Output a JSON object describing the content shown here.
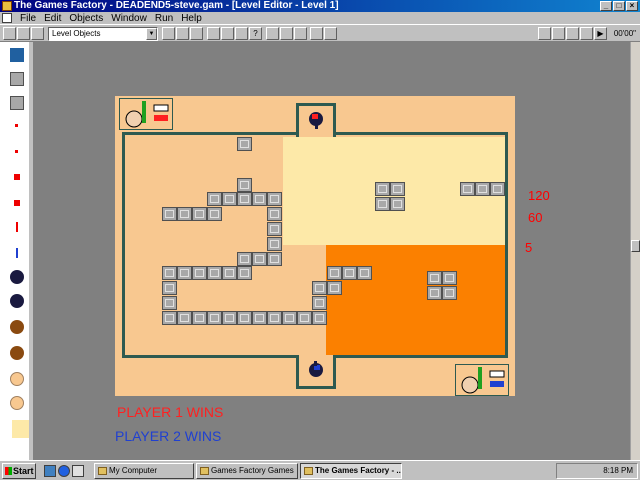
{
  "window": {
    "title": "The Games Factory - DEADEND5-steve.gam - [Level Editor - Level 1]",
    "controls": [
      "_",
      "□",
      "×"
    ]
  },
  "menu": [
    "File",
    "Edit",
    "Objects",
    "Window",
    "Run",
    "Help"
  ],
  "toolbar": {
    "object_selector": "Level Objects",
    "zoom": "00'00\""
  },
  "level": {
    "hud_numbers": [
      "120",
      "60",
      "5"
    ],
    "player1_text": "PLAYER 1 WINS",
    "player2_text": "PLAYER 2 WINS",
    "colors": {
      "background": "#f8c890",
      "wall": "#2e5a50",
      "yellow_zone": "#fde9a8",
      "orange_zone": "#fb8000",
      "player1": "#ff2020",
      "player2": "#2040d0"
    }
  },
  "taskbar": {
    "start_label": "Start",
    "tasks": [
      "My Computer",
      "Games Factory Games",
      "The Games Factory - ..."
    ],
    "clock": "8:18 PM"
  }
}
